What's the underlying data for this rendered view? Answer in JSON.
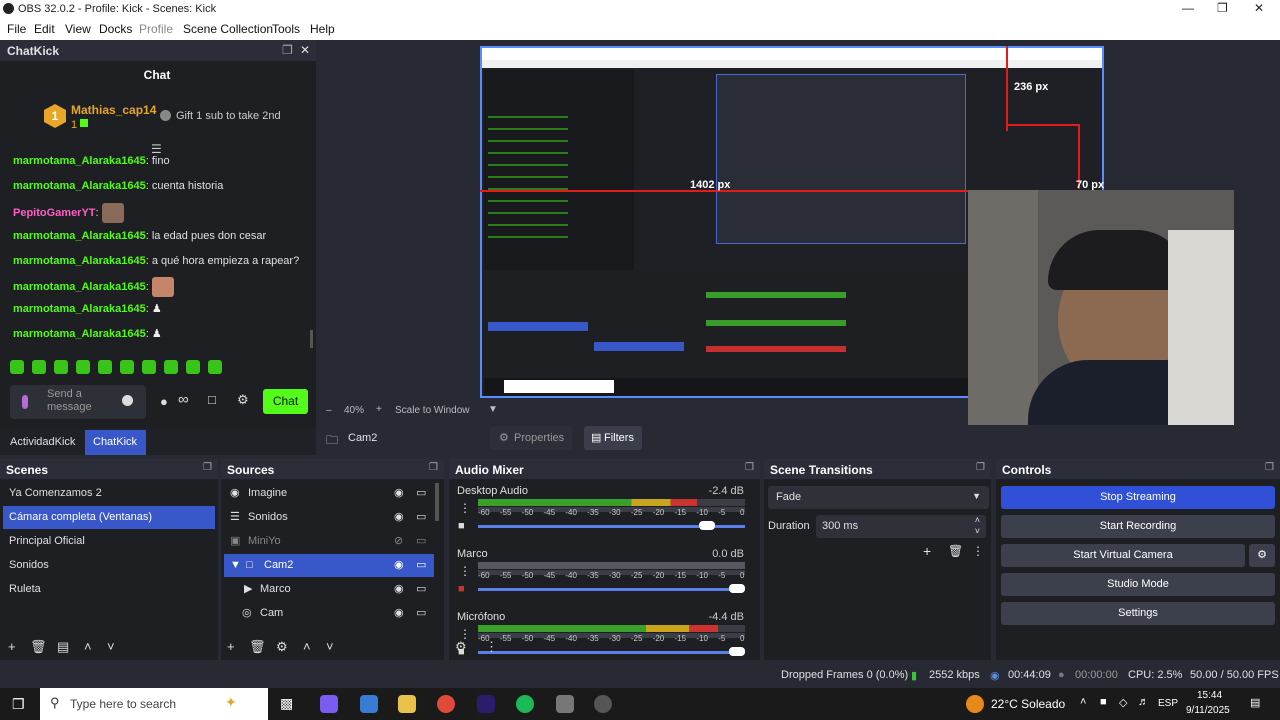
{
  "window": {
    "title": "OBS 32.0.2 - Profile: Kick - Scenes: Kick"
  },
  "menu": [
    "File",
    "Edit",
    "View",
    "Docks",
    "Profile",
    "Scene Collection",
    "Tools",
    "Help"
  ],
  "chat": {
    "dock_title": "ChatKick",
    "title": "Chat",
    "top_user": "Mathias_cap14",
    "top_rank": "1",
    "top_count": "1",
    "gift_text": "Gift 1 sub to take 2nd",
    "messages": [
      {
        "user": "marmotama_Alaraka1645",
        "text": "fino"
      },
      {
        "user": "marmotama_Alaraka1645",
        "text": "cuenta historia"
      },
      {
        "user": "PepitoGamerYT",
        "text": ""
      },
      {
        "user": "marmotama_Alaraka1645",
        "text": "la edad pues don cesar"
      },
      {
        "user": "marmotama_Alaraka1645",
        "text": "a qué hora empieza a rapear?"
      },
      {
        "user": "marmotama_Alaraka1645",
        "text": ""
      },
      {
        "user": "marmotama_Alaraka1645",
        "text": ""
      },
      {
        "user": "marmotama_Alaraka1645",
        "text": ""
      }
    ],
    "input_placeholder": "Send a message",
    "send_label": "Chat"
  },
  "dock_tabs": [
    "ActividadKick",
    "ChatKick"
  ],
  "preview": {
    "zoom": "40%",
    "scale_mode": "Scale to Window",
    "label_236": "236 px",
    "label_1402": "1402 px",
    "label_70": "70 px"
  },
  "context": {
    "source": "Cam2",
    "properties": "Properties",
    "filters": "Filters"
  },
  "scenes": {
    "title": "Scenes",
    "items": [
      "Ya Comenzamos 2",
      "Cámara completa (Ventanas)",
      "Principal Oficial",
      "Sonidos",
      "Ruleta"
    ]
  },
  "sources": {
    "title": "Sources",
    "items": [
      "Imagine",
      "Sonidos",
      "MiniYo",
      "Cam2",
      "Marco",
      "Cam"
    ]
  },
  "audio": {
    "title": "Audio Mixer",
    "channels": [
      {
        "name": "Desktop Audio",
        "db": "-2.4 dB",
        "level": 0.82
      },
      {
        "name": "Marco",
        "db": "0.0 dB",
        "level": 0.0
      },
      {
        "name": "Micrófono",
        "db": "-4.4 dB",
        "level": 0.9
      }
    ],
    "ticks": [
      "-60",
      "-55",
      "-50",
      "-45",
      "-40",
      "-35",
      "-30",
      "-25",
      "-20",
      "-15",
      "-10",
      "-5",
      "0"
    ]
  },
  "transitions": {
    "title": "Scene Transitions",
    "selected": "Fade",
    "duration_label": "Duration",
    "duration_value": "300 ms"
  },
  "controls": {
    "title": "Controls",
    "buttons": [
      "Stop Streaming",
      "Start Recording",
      "Start Virtual Camera",
      "Studio Mode",
      "Settings"
    ]
  },
  "status": {
    "dropped": "Dropped Frames 0 (0.0%)",
    "kbps": "2552 kbps",
    "stream_time": "00:44:09",
    "rec_time": "00:00:00",
    "cpu": "CPU: 2.5%",
    "fps": "50.00 / 50.00 FPS"
  },
  "taskbar": {
    "search_placeholder": "Type here to search",
    "weather": "22°C  Soleado",
    "lang": "ESP",
    "time": "15:44",
    "date": "9/11/2025"
  },
  "colors": {
    "kick_green": "#53fc18",
    "accent_blue": "#3857c9",
    "stop_streaming": "#3050d8"
  }
}
